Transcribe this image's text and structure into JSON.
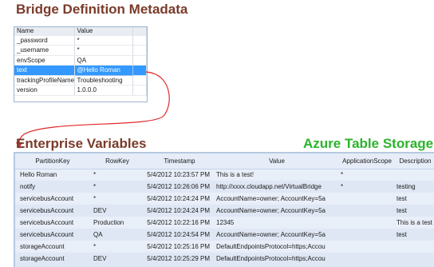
{
  "titles": {
    "bridge": "Bridge Definition Metadata",
    "enterprise": "Enterprise Variables",
    "azure": "Azure Table Storage"
  },
  "colors": {
    "heading": "#7a3b2a",
    "azure": "#2bb32b",
    "selection": "#3399ff",
    "arrow": "#e02a2a"
  },
  "property_grid": {
    "headers": [
      "Name",
      "Value"
    ],
    "rows": [
      {
        "name": "_password",
        "value": "*",
        "selected": false
      },
      {
        "name": "_username",
        "value": "*",
        "selected": false
      },
      {
        "name": "envScope",
        "value": "QA",
        "selected": false
      },
      {
        "name": "text",
        "value": "@Hello Roman",
        "selected": true
      },
      {
        "name": "trackingProfileName",
        "value": "Troubleshooting",
        "selected": false
      },
      {
        "name": "version",
        "value": "1.0.0.0",
        "selected": false
      }
    ]
  },
  "storage_table": {
    "headers": [
      "PartitionKey",
      "RowKey",
      "Timestamp",
      "Value",
      "ApplicationScope",
      "Description"
    ],
    "rows": [
      [
        "Hello Roman",
        "*",
        "5/4/2012 10:23:57 PM",
        "This is a test!",
        "*",
        ""
      ],
      [
        "notify",
        "*",
        "5/4/2012 10:26:06 PM",
        "http://xxxx.cloudapp.net/VirtualBridge",
        "*",
        "testing"
      ],
      [
        "servicebusAccount",
        "*",
        "5/4/2012 10:24:24 PM",
        "AccountName=owner; AccountKey=5a",
        "",
        "test"
      ],
      [
        "servicebusAccount",
        "DEV",
        "5/4/2012 10:24:24 PM",
        "AccountName=owner; AccountKey=5a",
        "",
        "test"
      ],
      [
        "servicebusAccount",
        "Production",
        "5/4/2012 10:22:16 PM",
        "12345",
        "",
        "This is a test"
      ],
      [
        "servicebusAccount",
        "QA",
        "5/4/2012 10:24:54 PM",
        "AccountName=owner; AccountKey=5a",
        "",
        "test"
      ],
      [
        "storageAccount",
        "*",
        "5/4/2012 10:25:16 PM",
        "DefaultEndpointsProtocol=https;Accou",
        "",
        ""
      ],
      [
        "storageAccount",
        "DEV",
        "5/4/2012 10:25:29 PM",
        "DefaultEndpointsProtocol=https;Accou",
        "",
        ""
      ]
    ]
  }
}
